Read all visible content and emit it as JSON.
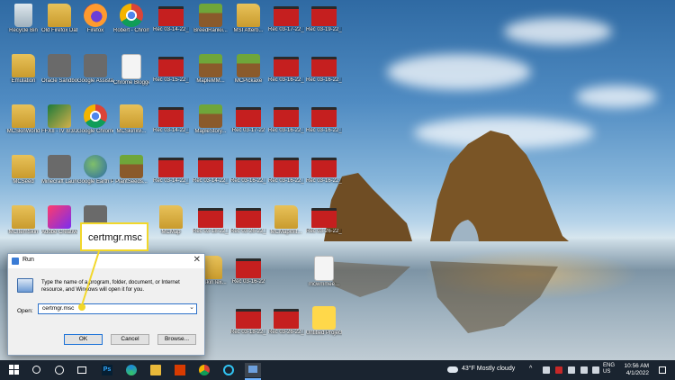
{
  "desktop": {
    "icons": [
      {
        "label": "Recycle Bin",
        "type": "recycle"
      },
      {
        "label": "Old Firefox Data",
        "type": "folder"
      },
      {
        "label": "Firefox",
        "type": "firefox"
      },
      {
        "label": "Robert - Chrome",
        "type": "chrome"
      },
      {
        "label": "Rec 03-14-22_002",
        "type": "video"
      },
      {
        "label": "BreedRankii...",
        "type": "game"
      },
      {
        "label": "MSI Afterb...",
        "type": "folder"
      },
      {
        "label": "Rec 03-17-22_003",
        "type": "video"
      },
      {
        "label": "Rec 03-19-22_003",
        "type": "video"
      },
      {
        "label": "Emulation",
        "type": "folder"
      },
      {
        "label": "Oracle Sandbox",
        "type": "app"
      },
      {
        "label": "Google Assistant",
        "type": "app"
      },
      {
        "label": "Chrome Blogger",
        "type": "doc"
      },
      {
        "label": "Rec 03-15-22_001",
        "type": "video"
      },
      {
        "label": "MapleMM...",
        "type": "game"
      },
      {
        "label": "MCPickaxe",
        "type": "game"
      },
      {
        "label": "Rec 03-16-22_003",
        "type": "video"
      },
      {
        "label": "Rec 03-16-22_003",
        "type": "video"
      },
      {
        "label": "MCSkinWorld",
        "type": "folder"
      },
      {
        "label": "FFXII - IV 8/3/2021",
        "type": "thumb"
      },
      {
        "label": "Google Chrome",
        "type": "chrome"
      },
      {
        "label": "MCSkinWi...",
        "type": "folder"
      },
      {
        "label": "Rec 03-14-22_001",
        "type": "video"
      },
      {
        "label": "MapleStory...",
        "type": "game"
      },
      {
        "label": "Rec 03-17-22",
        "type": "video"
      },
      {
        "label": "Rec 03-16-22_002",
        "type": "video"
      },
      {
        "label": "Rec 03-16-22_004",
        "type": "video"
      },
      {
        "label": "MCSeed",
        "type": "folder"
      },
      {
        "label": "Minecraft Launcher",
        "type": "app"
      },
      {
        "label": "Google Earth Pro",
        "type": "earth"
      },
      {
        "label": "PlantSeeds...",
        "type": "game"
      },
      {
        "label": "Rec 03-14-22_003",
        "type": "video"
      },
      {
        "label": "Rec 03-14-22_004",
        "type": "video"
      },
      {
        "label": "Rec 03-16-22_002",
        "type": "video"
      },
      {
        "label": "Rec 03-16-22_005",
        "type": "video"
      },
      {
        "label": "Rec 03-16-22_006",
        "type": "video"
      },
      {
        "label": "MCItemSkin",
        "type": "folder"
      },
      {
        "label": "Adobe Creative Cloud",
        "type": "adobe"
      },
      {
        "label": "Zoom",
        "type": "app"
      },
      {
        "label": "MCMap",
        "type": "folder"
      },
      {
        "label": "Rec 03-18-22_001",
        "type": "video"
      },
      {
        "label": "Rec 03-26-22_001",
        "type": "video"
      },
      {
        "label": "MCMapWit...",
        "type": "folder"
      },
      {
        "label": "Rec 03-26-22_002",
        "type": "video"
      },
      {
        "label": "MCSkinTex...",
        "type": "folder"
      },
      {
        "label": "Rec 03-16-22",
        "type": "video"
      },
      {
        "label": "mcwmmee...",
        "type": "doc"
      },
      {
        "label": "Rec 03-18-22_003",
        "type": "video"
      },
      {
        "label": "Rec 03-26-22_001",
        "type": "video"
      },
      {
        "label": "Untitled Project",
        "type": "note"
      }
    ]
  },
  "callout": {
    "text": "certmgr.msc"
  },
  "run_dialog": {
    "title": "Run",
    "close_glyph": "✕",
    "description": "Type the name of a program, folder, document, or Internet resource, and Windows will open it for you.",
    "open_label": "Open:",
    "input_value": "certmgr.msc",
    "dropdown_glyph": "⌄",
    "ok_label": "OK",
    "cancel_label": "Cancel",
    "browse_label": "Browse..."
  },
  "taskbar": {
    "ps_label": "Ps",
    "weather": "43°F  Mostly cloudy",
    "tray_chevron": "^",
    "lang_1": "ENG",
    "lang_2": "US",
    "time": "10:56 AM",
    "date": "4/1/2022"
  }
}
